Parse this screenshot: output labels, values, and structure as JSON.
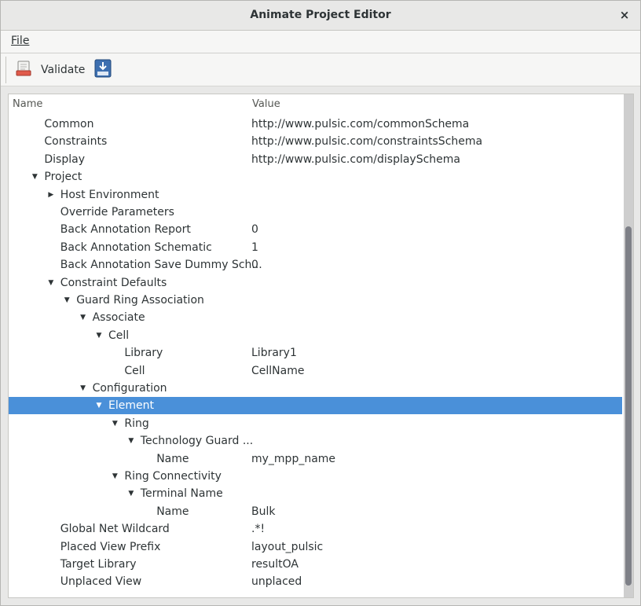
{
  "window": {
    "title": "Animate Project Editor",
    "close_glyph": "×"
  },
  "menubar": {
    "file_label": "File"
  },
  "toolbar": {
    "validate_label": "Validate",
    "validate_icon": "document-validate-icon",
    "download_icon": "download-icon"
  },
  "tree": {
    "columns": {
      "name": "Name",
      "value": "Value"
    },
    "selection_color": "#4a90d9",
    "scroll_position_fraction": 0.27,
    "rows": [
      {
        "name": "Common",
        "value": "http://www.pulsic.com/commonSchema",
        "depth": 1,
        "expander": ""
      },
      {
        "name": "Constraints",
        "value": "http://www.pulsic.com/constraintsSchema",
        "depth": 1,
        "expander": ""
      },
      {
        "name": "Display",
        "value": "http://www.pulsic.com/displaySchema",
        "depth": 1,
        "expander": ""
      },
      {
        "name": "Project",
        "value": "",
        "depth": 1,
        "expander": "expanded"
      },
      {
        "name": "Host Environment",
        "value": "",
        "depth": 2,
        "expander": "collapsed"
      },
      {
        "name": "Override Parameters",
        "value": "",
        "depth": 2,
        "expander": ""
      },
      {
        "name": "Back Annotation Report",
        "value": "0",
        "depth": 2,
        "expander": ""
      },
      {
        "name": "Back Annotation Schematic",
        "value": "1",
        "depth": 2,
        "expander": ""
      },
      {
        "name": "Back Annotation Save Dummy Sch...",
        "value": "0",
        "depth": 2,
        "expander": ""
      },
      {
        "name": "Constraint Defaults",
        "value": "",
        "depth": 2,
        "expander": "expanded"
      },
      {
        "name": "Guard Ring Association",
        "value": "",
        "depth": 3,
        "expander": "expanded"
      },
      {
        "name": "Associate",
        "value": "",
        "depth": 4,
        "expander": "expanded"
      },
      {
        "name": "Cell",
        "value": "",
        "depth": 5,
        "expander": "expanded"
      },
      {
        "name": "Library",
        "value": "Library1",
        "depth": 6,
        "expander": ""
      },
      {
        "name": "Cell",
        "value": "CellName",
        "depth": 6,
        "expander": ""
      },
      {
        "name": "Configuration",
        "value": "",
        "depth": 4,
        "expander": "expanded"
      },
      {
        "name": "Element",
        "value": "",
        "depth": 5,
        "expander": "expanded",
        "selected": true
      },
      {
        "name": "Ring",
        "value": "",
        "depth": 6,
        "expander": "expanded"
      },
      {
        "name": "Technology Guard ...",
        "value": "",
        "depth": 7,
        "expander": "expanded"
      },
      {
        "name": "Name",
        "value": "my_mpp_name",
        "depth": 8,
        "expander": ""
      },
      {
        "name": "Ring Connectivity",
        "value": "",
        "depth": 6,
        "expander": "expanded"
      },
      {
        "name": "Terminal Name",
        "value": "",
        "depth": 7,
        "expander": "expanded"
      },
      {
        "name": "Name",
        "value": "Bulk",
        "depth": 8,
        "expander": ""
      },
      {
        "name": "Global Net Wildcard",
        "value": ".*!",
        "depth": 2,
        "expander": ""
      },
      {
        "name": "Placed View Prefix",
        "value": "layout_pulsic",
        "depth": 2,
        "expander": ""
      },
      {
        "name": "Target Library",
        "value": "resultOA",
        "depth": 2,
        "expander": ""
      },
      {
        "name": "Unplaced View",
        "value": "unplaced",
        "depth": 2,
        "expander": ""
      }
    ]
  }
}
